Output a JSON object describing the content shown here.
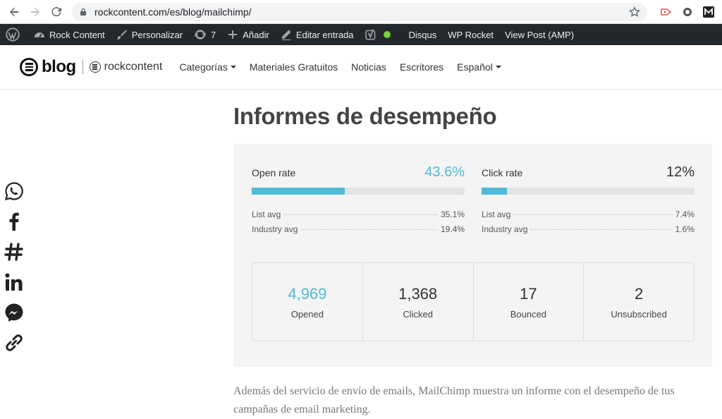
{
  "browser": {
    "url": "rockcontent.com/es/blog/mailchimp/"
  },
  "adminbar": {
    "items": [
      {
        "label": "Rock Content"
      },
      {
        "label": "Personalizar"
      },
      {
        "label": "7"
      },
      {
        "label": "Añadir"
      },
      {
        "label": "Editar entrada"
      },
      {
        "label": "Disqus"
      },
      {
        "label": "WP Rocket"
      },
      {
        "label": "View Post (AMP)"
      }
    ]
  },
  "header": {
    "logo_blog": "blog",
    "logo_rc": "rockcontent",
    "menu": [
      {
        "label": "Categorías"
      },
      {
        "label": "Materiales Gratuitos"
      },
      {
        "label": "Noticias"
      },
      {
        "label": "Escritores"
      },
      {
        "label": "Español"
      }
    ]
  },
  "share_icons": [
    "whatsapp-icon",
    "facebook-icon",
    "slack-icon",
    "linkedin-icon",
    "messenger-icon",
    "link-icon"
  ],
  "article": {
    "title": "Informes de desempeño",
    "paragraph": "Además del servicio de envío de emails, MailChimp muestra un informe con el desempeño de tus campañas de email marketing."
  },
  "report": {
    "open": {
      "label": "Open rate",
      "value": "43.6%",
      "fill_percent": 43.6,
      "list_avg_label": "List avg",
      "list_avg": "35.1%",
      "industry_avg_label": "Industry avg",
      "industry_avg": "19.4%"
    },
    "click": {
      "label": "Click rate",
      "value": "12%",
      "fill_percent": 12,
      "list_avg_label": "List avg",
      "list_avg": "7.4%",
      "industry_avg_label": "Industry avg",
      "industry_avg": "1.6%"
    },
    "stats": [
      {
        "number": "4,969",
        "label": "Opened"
      },
      {
        "number": "1,368",
        "label": "Clicked"
      },
      {
        "number": "17",
        "label": "Bounced"
      },
      {
        "number": "2",
        "label": "Unsubscribed"
      }
    ]
  },
  "colors": {
    "accent": "#52bad5",
    "adminbar": "#23282d"
  }
}
